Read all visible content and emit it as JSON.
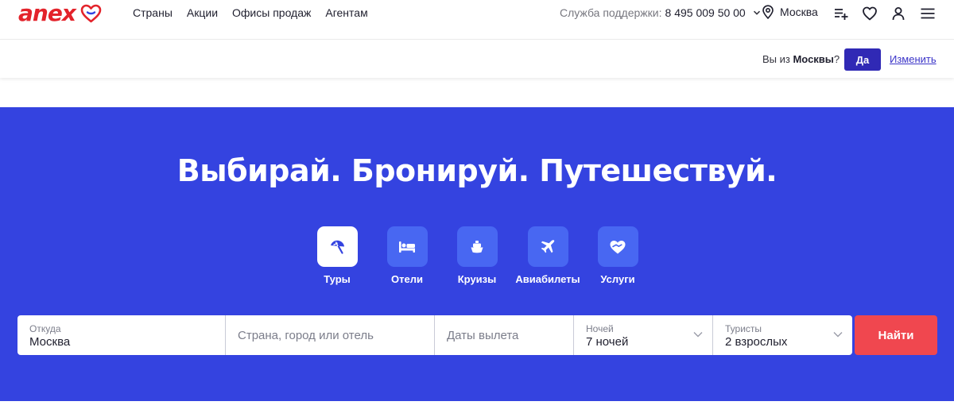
{
  "header": {
    "logo_text": "anex",
    "nav": [
      "Страны",
      "Акции",
      "Офисы продаж",
      "Агентам"
    ],
    "support_label": "Служба поддержки:",
    "support_phone": "8 495 009 50 00",
    "city": "Москва"
  },
  "geo_prompt": {
    "question_prefix": "Вы из ",
    "question_city": "Москвы",
    "question_suffix": "?",
    "yes_label": "Да",
    "change_label": "Изменить"
  },
  "hero": {
    "headline": "Выбирай. Бронируй. Путешествуй.",
    "tabs": [
      {
        "label": "Туры",
        "icon": "umbrella-icon",
        "active": true
      },
      {
        "label": "Отели",
        "icon": "bed-icon",
        "active": false
      },
      {
        "label": "Круизы",
        "icon": "ship-icon",
        "active": false
      },
      {
        "label": "Авиабилеты",
        "icon": "plane-icon",
        "active": false
      },
      {
        "label": "Услуги",
        "icon": "heart-hand-icon",
        "active": false
      }
    ]
  },
  "search": {
    "from_label": "Откуда",
    "from_value": "Москва",
    "destination_placeholder": "Страна, город или отель",
    "dates_placeholder": "Даты вылета",
    "nights_label": "Ночей",
    "nights_value": "7 ночей",
    "tourists_label": "Туристы",
    "tourists_value": "2 взрослых",
    "find_label": "Найти"
  },
  "colors": {
    "brand_red": "#e3232b",
    "hero_blue": "#3443e0",
    "tab_blue": "#4867f2",
    "yes_button": "#3029b5",
    "find_button": "#f0474f"
  }
}
